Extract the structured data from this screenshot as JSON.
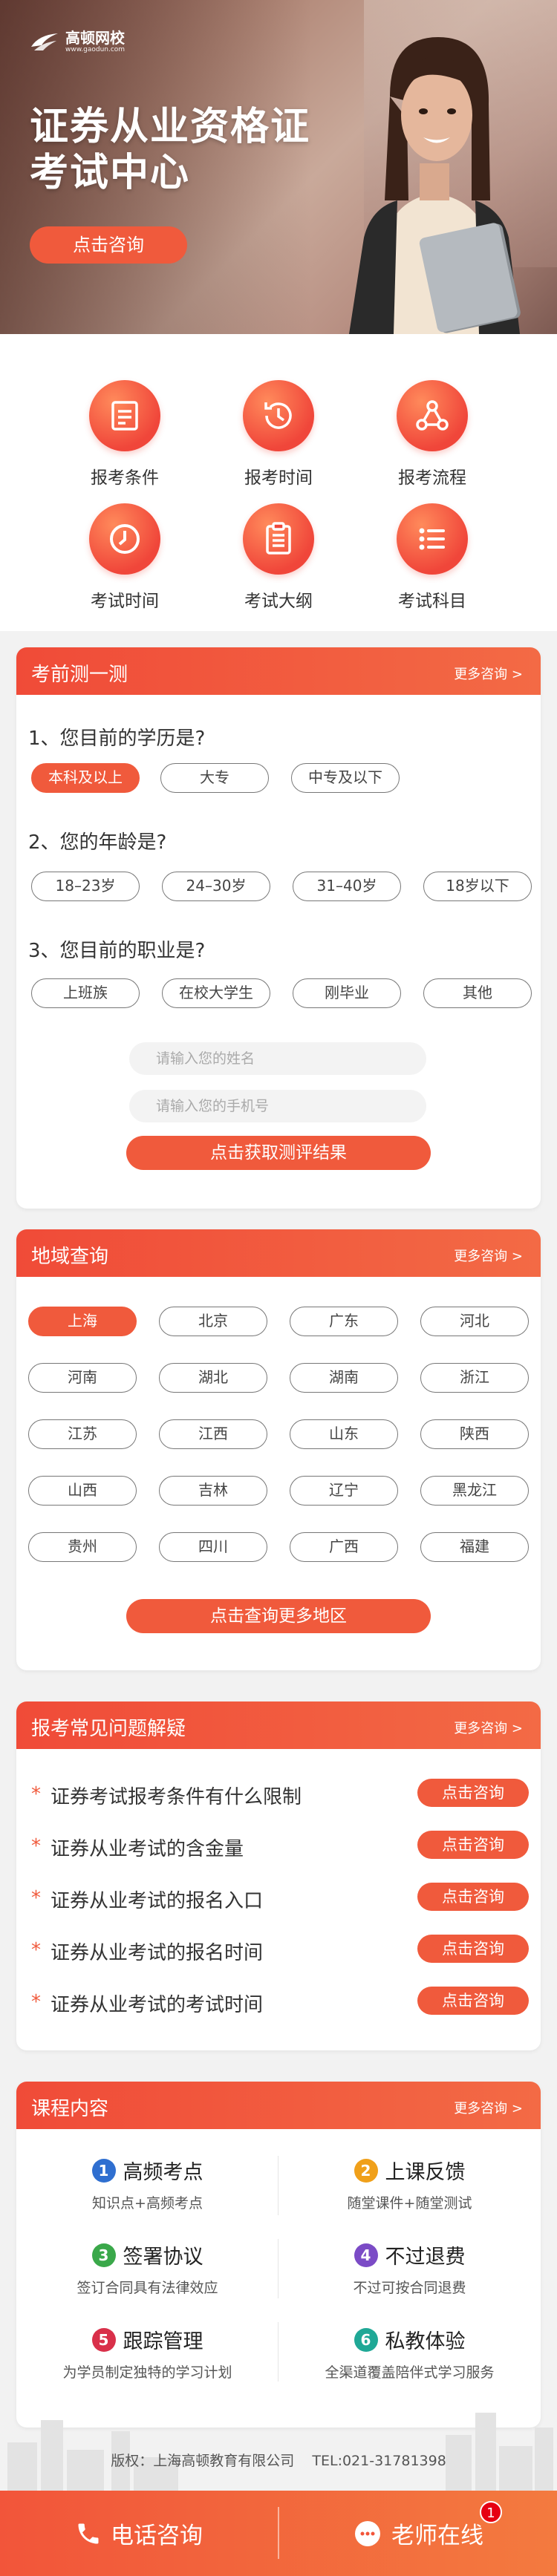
{
  "hero": {
    "logo_name": "高顿网校",
    "logo_url": "www.gaodun.com",
    "title_line1": "证券从业资格证",
    "title_line2": "考试中心",
    "consult_button": "点击咨询"
  },
  "grid": [
    {
      "label": "报考条件",
      "icon": "checklist-icon"
    },
    {
      "label": "报考时间",
      "icon": "history-clock-icon"
    },
    {
      "label": "报考流程",
      "icon": "flow-nodes-icon"
    },
    {
      "label": "考试时间",
      "icon": "clock-icon"
    },
    {
      "label": "考试大纲",
      "icon": "document-list-icon"
    },
    {
      "label": "考试科目",
      "icon": "menu-list-icon"
    }
  ],
  "test": {
    "title": "考前测一测",
    "more": "更多咨询 >",
    "q1": "1、您目前的学历是?",
    "q1_options": [
      "本科及以上",
      "大专",
      "中专及以下"
    ],
    "q2": "2、您的年龄是?",
    "q2_options": [
      "18–23岁",
      "24–30岁",
      "31–40岁",
      "18岁以下"
    ],
    "q3": "3、您目前的职业是?",
    "q3_options": [
      "上班族",
      "在校大学生",
      "刚毕业",
      "其他"
    ],
    "name_placeholder": "请输入您的姓名",
    "phone_placeholder": "请输入您的手机号",
    "submit": "点击获取测评结果"
  },
  "region": {
    "title": "地域查询",
    "more": "更多咨询 >",
    "items": [
      "上海",
      "北京",
      "广东",
      "河北",
      "河南",
      "湖北",
      "湖南",
      "浙江",
      "江苏",
      "江西",
      "山东",
      "陕西",
      "山西",
      "吉林",
      "辽宁",
      "黑龙江",
      "贵州",
      "四川",
      "广西",
      "福建"
    ],
    "button": "点击查询更多地区"
  },
  "faq": {
    "title": "报考常见问题解疑",
    "more": "更多咨询 >",
    "items": [
      "证券考试报考条件有什么限制",
      "证券从业考试的含金量",
      "证券从业考试的报名入口",
      "证券从业考试的报名时间",
      "证券从业考试的考试时间"
    ],
    "button": "点击咨询"
  },
  "course": {
    "title": "课程内容",
    "more": "更多咨询 >",
    "items": [
      {
        "num": "1",
        "title": "高频考点",
        "sub": "知识点+高频考点",
        "color": "#2f6fd0"
      },
      {
        "num": "2",
        "title": "上课反馈",
        "sub": "随堂课件+随堂测试",
        "color": "#f0a01a"
      },
      {
        "num": "3",
        "title": "签署协议",
        "sub": "签订合同具有法律效应",
        "color": "#3aa84a"
      },
      {
        "num": "4",
        "title": "不过退费",
        "sub": "不过可按合同退费",
        "color": "#7b4bc6"
      },
      {
        "num": "5",
        "title": "跟踪管理",
        "sub": "为学员制定独特的学习计划",
        "color": "#d9304a"
      },
      {
        "num": "6",
        "title": "私教体验",
        "sub": "全渠道覆盖陪伴式学习服务",
        "color": "#1fa896"
      }
    ]
  },
  "footer": {
    "copyright": "版权：上海高顿教育有限公司",
    "tel": "TEL:021-31781398"
  },
  "bottombar": {
    "phone": "电话咨询",
    "teacher": "老师在线",
    "badge": "1"
  },
  "colors": {
    "accent": "#f05a3c",
    "header_gradient_end": "#f36a45"
  }
}
